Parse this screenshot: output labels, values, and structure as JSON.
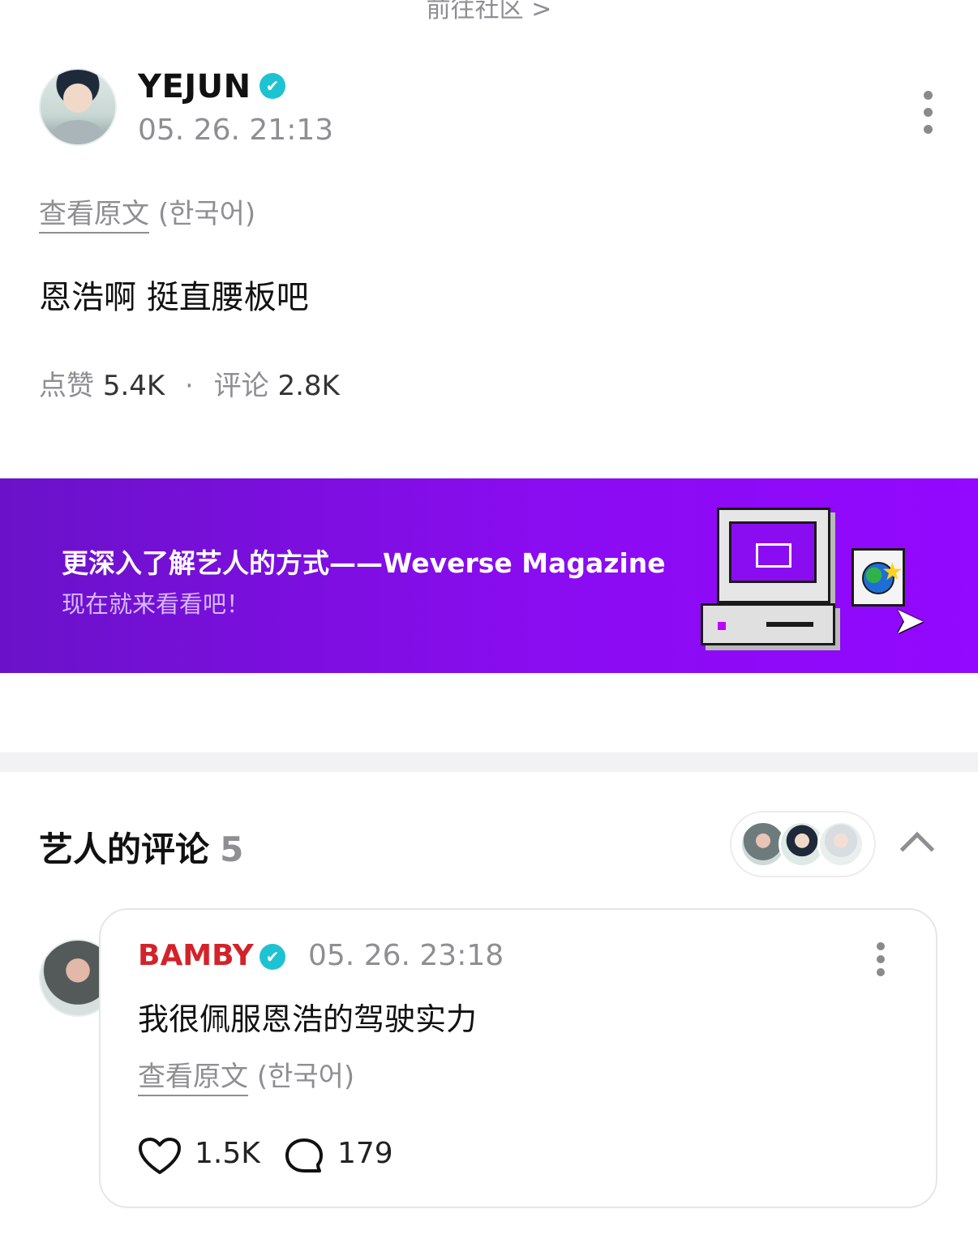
{
  "top": {
    "community_link": "前往社区 >"
  },
  "post": {
    "author": "YEJUN",
    "verified_icon": "✔",
    "time": "05. 26. 21:13",
    "view_original": "查看原文",
    "original_lang": "(한국어)",
    "body": "恩浩啊 挺直腰板吧",
    "likes_label": "点赞",
    "likes_value": "5.4K",
    "dot": "·",
    "comments_label": "评论",
    "comments_value": "2.8K"
  },
  "banner": {
    "title": "更深入了解艺人的方式——Weverse Magazine",
    "subtitle": "现在就来看看吧！"
  },
  "artist_comments": {
    "title": "艺人的评论",
    "count": "5",
    "comment": {
      "author": "BAMBY",
      "author_color": "#d2232a",
      "verified_icon": "✔",
      "time": "05. 26. 23:18",
      "body": "我很佩服恩浩的驾驶实力",
      "view_original": "查看原文",
      "original_lang": "(한국어)",
      "likes": "1.5K",
      "replies": "179"
    }
  },
  "icons": {
    "verified": "verified-badge-icon",
    "more": "more-vertical-icon",
    "collapse": "chevron-up-icon",
    "like": "heart-icon",
    "reply": "comment-bubble-icon"
  },
  "colors": {
    "accent_verified": "#1ec3d1",
    "banner_start": "#6a12c9",
    "banner_end": "#9308ff",
    "muted_text": "#8e8e93"
  }
}
